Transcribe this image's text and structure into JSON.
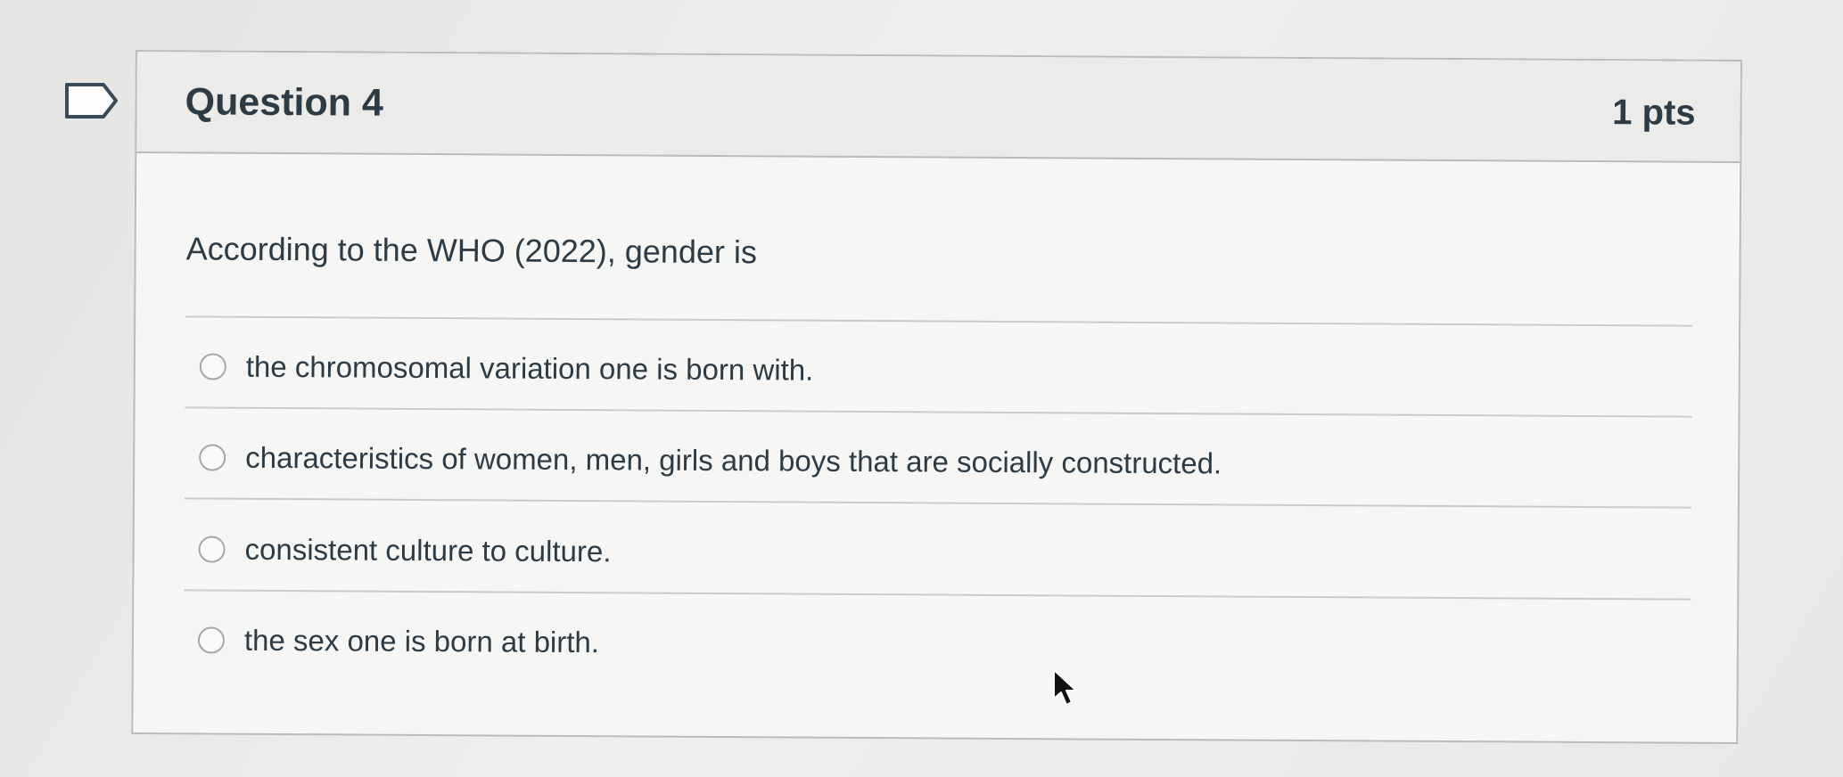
{
  "question": {
    "title": "Question 4",
    "points": "1 pts",
    "prompt": "According to the WHO (2022), gender is",
    "answers": [
      {
        "label": "the chromosomal variation one is born with."
      },
      {
        "label": "characteristics of women, men, girls and boys that are socially constructed."
      },
      {
        "label": "consistent culture to culture."
      },
      {
        "label": "the sex one is born at birth."
      }
    ]
  },
  "icons": {
    "flag": "flag-icon",
    "radio": "radio-icon",
    "cursor": "mouse-cursor-icon"
  },
  "colors": {
    "text": "#2d3b45",
    "border": "#b9bcbf",
    "header_bg": "#ebebe9",
    "card_bg": "#f6f6f4"
  }
}
